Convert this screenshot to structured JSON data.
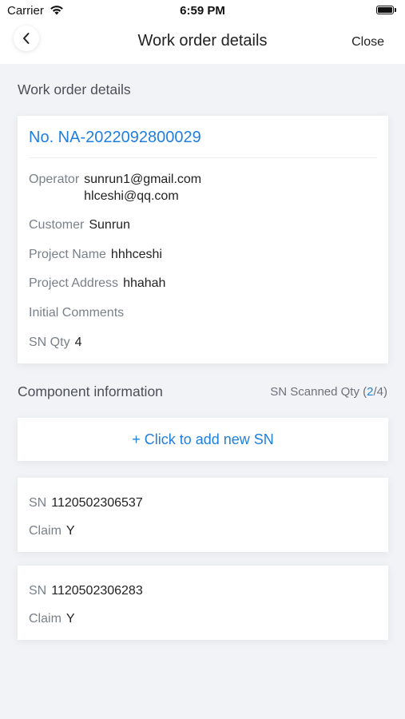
{
  "status_bar": {
    "carrier": "Carrier",
    "time": "6:59 PM"
  },
  "nav": {
    "title": "Work order details",
    "close": "Close"
  },
  "details": {
    "section_title": "Work order details",
    "order_no": "No. NA-2022092800029",
    "operator_label": "Operator",
    "operators": [
      "sunrun1@gmail.com",
      "hlceshi@qq.com"
    ],
    "customer_label": "Customer",
    "customer": "Sunrun",
    "project_name_label": "Project Name",
    "project_name": "hhhceshi",
    "project_address_label": "Project Address",
    "project_address": "hhahah",
    "initial_comments_label": "Initial Comments",
    "sn_qty_label": "SN Qty",
    "sn_qty": "4"
  },
  "components": {
    "section_title": "Component information",
    "scanned_prefix": "SN Scanned Qty (",
    "scanned_count": "2",
    "scanned_suffix": "/4)",
    "add_sn": "+ Click to add new SN",
    "items": [
      {
        "sn_label": "SN",
        "sn": "1120502306537",
        "claim_label": "Claim",
        "claim": "Y"
      },
      {
        "sn_label": "SN",
        "sn": "1120502306283",
        "claim_label": "Claim",
        "claim": "Y"
      }
    ]
  },
  "colors": {
    "accent": "#1f7fe0",
    "background": "#f2f3f7"
  }
}
